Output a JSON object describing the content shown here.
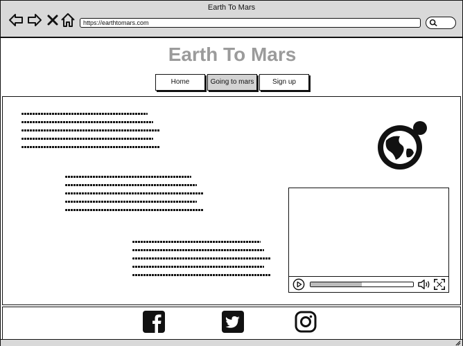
{
  "window": {
    "title": "Earth To Mars"
  },
  "browser": {
    "url": "https://earthtomars.com"
  },
  "page": {
    "title": "Earth To Mars"
  },
  "nav": [
    {
      "label": "Home"
    },
    {
      "label": "Going to mars"
    },
    {
      "label": "Sign up"
    }
  ],
  "colors": {
    "title": "#9b9b9b",
    "chrome": "#d9d9d9",
    "active_tab": "#d3d3d3"
  },
  "icons": [
    "back-arrow-icon",
    "forward-arrow-icon",
    "close-icon",
    "home-icon",
    "search-icon",
    "globe-icon",
    "play-icon",
    "volume-icon",
    "fullscreen-icon",
    "facebook-icon",
    "twitter-icon",
    "instagram-icon"
  ]
}
